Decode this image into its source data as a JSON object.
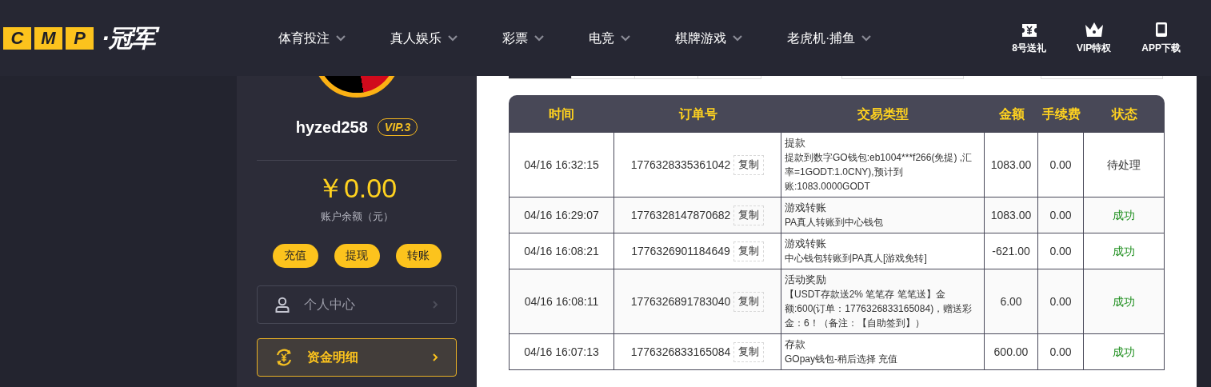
{
  "logo": {
    "letters": [
      "C",
      "M",
      "P"
    ],
    "name": "·冠军"
  },
  "nav": [
    {
      "label": "体育投注"
    },
    {
      "label": "真人娱乐"
    },
    {
      "label": "彩票"
    },
    {
      "label": "电竞"
    },
    {
      "label": "棋牌游戏"
    },
    {
      "label": "老虎机·捕鱼"
    }
  ],
  "header_links": [
    {
      "kind": "gift",
      "label": "8号送礼"
    },
    {
      "kind": "vip",
      "label": "VIP特权"
    },
    {
      "kind": "app",
      "label": "APP下载"
    }
  ],
  "profile": {
    "username": "hyzed258",
    "vip": "VIP.3",
    "balance": "￥0.00",
    "balance_label": "账户余额（元）",
    "actions": [
      "充值",
      "提现",
      "转账"
    ]
  },
  "menu": [
    {
      "kind": "user",
      "label": "个人中心",
      "selected": false
    },
    {
      "kind": "money",
      "label": "资金明细",
      "selected": true
    }
  ],
  "tabs": [
    {
      "selected": true
    },
    {
      "selected": false
    },
    {
      "selected": false
    },
    {
      "selected": false
    }
  ],
  "table": {
    "columns": [
      "时间",
      "订单号",
      "交易类型",
      "金额",
      "手续费",
      "状态"
    ],
    "rows": [
      {
        "time": "04/16 16:32:15",
        "order": "1776328335361042",
        "copy_label": "复制",
        "type": "提款",
        "detail": "提款到数字GO钱包:eb1004***f266(免提) ,汇率=1GODT:1.0CNY),预计到账:1083.0000GODT",
        "amount": "1083.00",
        "fee": "0.00",
        "status": "待处理",
        "kind": "pending"
      },
      {
        "time": "04/16 16:29:07",
        "order": "1776328147870682",
        "copy_label": "复制",
        "type": "游戏转账",
        "detail": "PA真人转账到中心钱包",
        "amount": "1083.00",
        "fee": "0.00",
        "status": "成功",
        "kind": "success"
      },
      {
        "time": "04/16 16:08:21",
        "order": "1776326901184649",
        "copy_label": "复制",
        "type": "游戏转账",
        "detail": "中心钱包转账到PA真人[游戏免转]",
        "amount": "-621.00",
        "fee": "0.00",
        "status": "成功",
        "kind": "success"
      },
      {
        "time": "04/16 16:08:11",
        "order": "1776326891783040",
        "copy_label": "复制",
        "type": "活动奖励",
        "detail": "【USDT存款送2% 笔笔存 笔笔送】金额:600(订单：1776326833165084)，赠送彩金：6！（备注：【自助签到】）",
        "amount": "6.00",
        "fee": "0.00",
        "status": "成功",
        "kind": "success"
      },
      {
        "time": "04/16 16:07:13",
        "order": "1776326833165084",
        "copy_label": "复制",
        "type": "存款",
        "detail": "GOpay钱包-稍后选择 充值",
        "amount": "600.00",
        "fee": "0.00",
        "status": "成功",
        "kind": "success"
      }
    ]
  }
}
